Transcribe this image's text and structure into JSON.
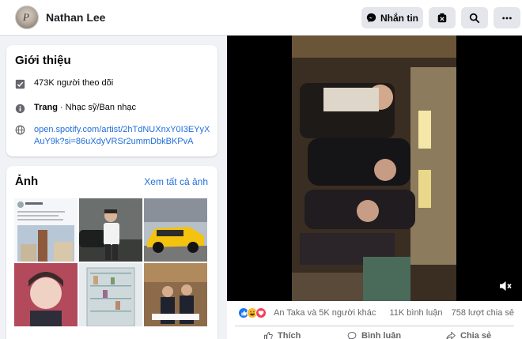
{
  "header": {
    "name": "Nathan Lee",
    "message_label": "Nhắn tin"
  },
  "intro": {
    "title": "Giới thiệu",
    "followers": "473K người theo dõi",
    "page_type": "Trang",
    "category": "· Nhạc sỹ/Ban nhạc",
    "link": "open.spotify.com/artist/2hTdNUXnxY0I3EYyXAuY9k?si=86uXdyVRSr2ummDbkBKPvA"
  },
  "photos": {
    "title": "Ảnh",
    "see_all": "Xem tất cả ảnh"
  },
  "post": {
    "reaction_names": "An Taka và 5K người khác",
    "comments": "11K bình luận",
    "shares": "758 lượt chia sẻ",
    "like_label": "Thích",
    "comment_label": "Bình luận",
    "share_label": "Chia sẻ"
  },
  "colors": {
    "accent": "#216fdb",
    "like": "#1877f2",
    "haha": "#f7b928",
    "love": "#f33e58"
  },
  "icons": [
    "messenger-icon",
    "shield-icon",
    "search-icon",
    "more-icon",
    "checkbox-icon",
    "info-icon",
    "globe-icon",
    "volume-muted-icon",
    "like-icon",
    "comment-icon",
    "share-icon"
  ]
}
